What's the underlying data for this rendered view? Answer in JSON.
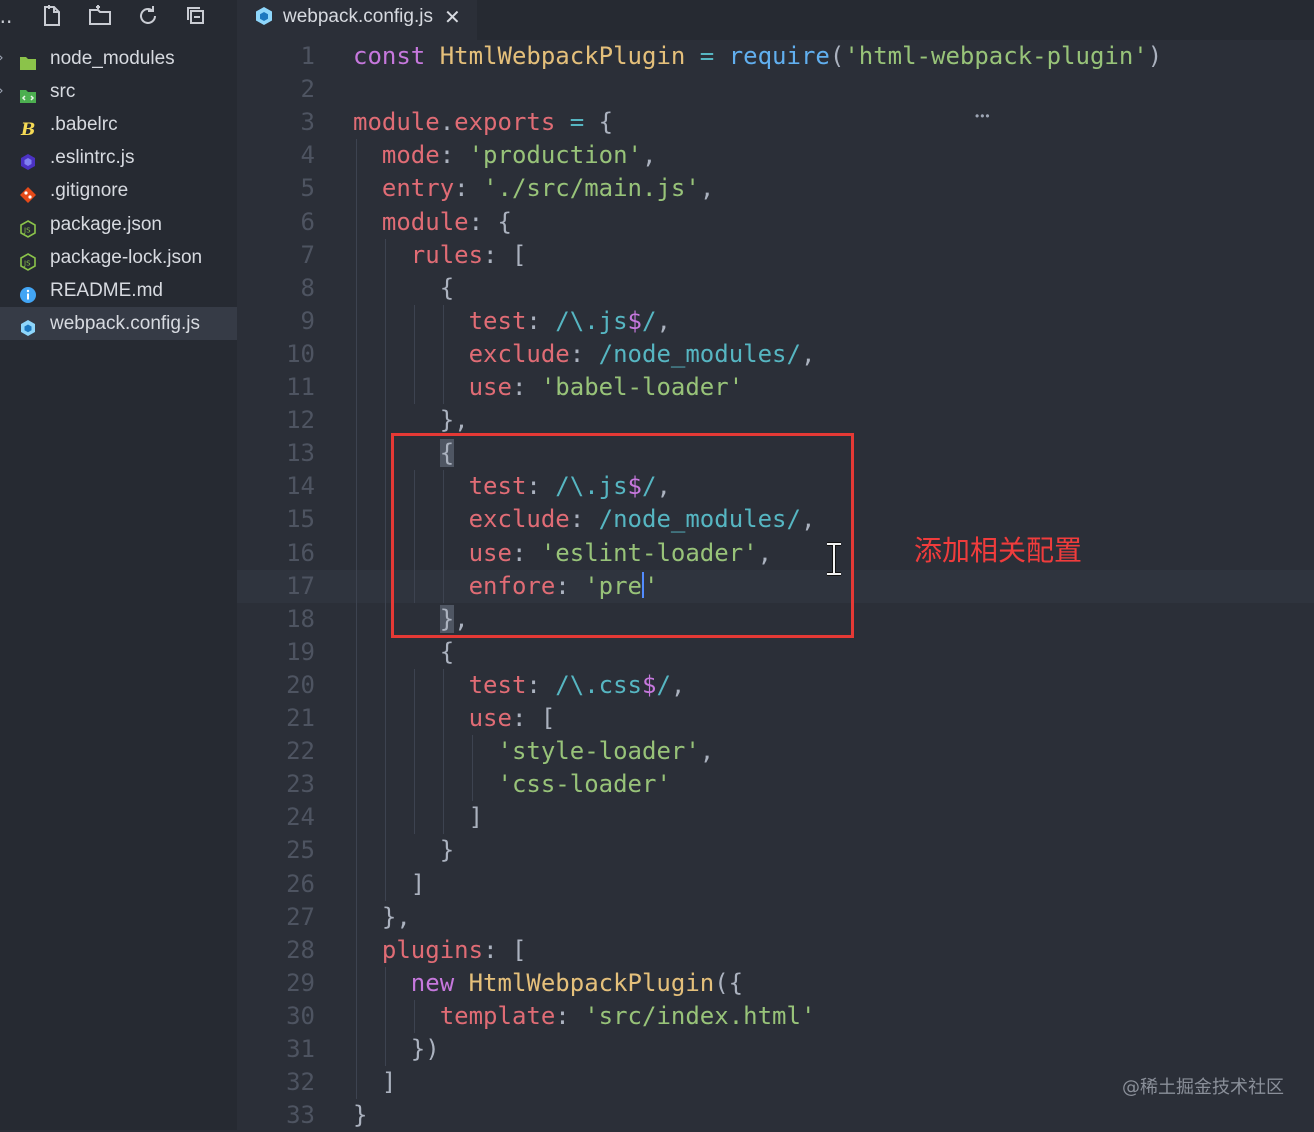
{
  "colors": {
    "sidebar_bg": "#262a32",
    "editor_bg": "#2b2f38",
    "annotation_red": "#e53935",
    "keyword": "#c678dd",
    "class_name": "#e5c07b",
    "function": "#61afef",
    "string": "#98c379",
    "property": "#e06c75",
    "regex": "#56b6c2",
    "line_number": "#4e5461"
  },
  "sidebar": {
    "toolbar_icons": [
      "new-file-icon",
      "new-folder-icon",
      "refresh-icon",
      "collapse-all-icon"
    ],
    "items": [
      {
        "label": "node_modules",
        "icon": "folder-icon",
        "chevron": "›"
      },
      {
        "label": "src",
        "icon": "src-folder-icon",
        "chevron": "›"
      },
      {
        "label": ".babelrc",
        "icon": "babel-icon",
        "chevron": ""
      },
      {
        "label": ".eslintrc.js",
        "icon": "eslint-icon",
        "chevron": ""
      },
      {
        "label": ".gitignore",
        "icon": "git-icon",
        "chevron": ""
      },
      {
        "label": "package.json",
        "icon": "node-icon",
        "chevron": ""
      },
      {
        "label": "package-lock.json",
        "icon": "node-icon",
        "chevron": ""
      },
      {
        "label": "README.md",
        "icon": "info-icon",
        "chevron": ""
      },
      {
        "label": "webpack.config.js",
        "icon": "webpack-icon",
        "chevron": "",
        "selected": true
      }
    ]
  },
  "tab": {
    "label": "webpack.config.js",
    "close": "✕",
    "icon": "webpack-icon"
  },
  "editor": {
    "current_line": 17,
    "lines": [
      {
        "n": "1",
        "tokens": [
          [
            "kw",
            "const "
          ],
          [
            "cls",
            "HtmlWebpackPlugin"
          ],
          [
            "pn",
            " "
          ],
          [
            "op",
            "="
          ],
          [
            "pn",
            " "
          ],
          [
            "fn",
            "require"
          ],
          [
            "pn",
            "("
          ],
          [
            "str",
            "'html-webpack-plugin'"
          ],
          [
            "pn",
            ")"
          ]
        ]
      },
      {
        "n": "2",
        "tokens": []
      },
      {
        "n": "3",
        "tokens": [
          [
            "prop",
            "module"
          ],
          [
            "pn",
            "."
          ],
          [
            "prop",
            "exports"
          ],
          [
            "pn",
            " "
          ],
          [
            "op",
            "="
          ],
          [
            "pn",
            " {"
          ]
        ]
      },
      {
        "n": "4",
        "tokens": [
          [
            "pn",
            "  "
          ],
          [
            "prop",
            "mode"
          ],
          [
            "pn",
            ": "
          ],
          [
            "str",
            "'production'"
          ],
          [
            "pn",
            ","
          ]
        ]
      },
      {
        "n": "5",
        "tokens": [
          [
            "pn",
            "  "
          ],
          [
            "prop",
            "entry"
          ],
          [
            "pn",
            ": "
          ],
          [
            "str",
            "'./src/main.js'"
          ],
          [
            "pn",
            ","
          ]
        ]
      },
      {
        "n": "6",
        "tokens": [
          [
            "pn",
            "  "
          ],
          [
            "prop",
            "module"
          ],
          [
            "pn",
            ": {"
          ]
        ]
      },
      {
        "n": "7",
        "tokens": [
          [
            "pn",
            "    "
          ],
          [
            "prop",
            "rules"
          ],
          [
            "pn",
            ": ["
          ]
        ]
      },
      {
        "n": "8",
        "tokens": [
          [
            "pn",
            "      {"
          ]
        ]
      },
      {
        "n": "9",
        "tokens": [
          [
            "pn",
            "        "
          ],
          [
            "prop",
            "test"
          ],
          [
            "pn",
            ": "
          ],
          [
            "re",
            "/\\.js"
          ],
          [
            "red",
            "$"
          ],
          [
            "re",
            "/"
          ],
          [
            "pn",
            ","
          ]
        ]
      },
      {
        "n": "10",
        "tokens": [
          [
            "pn",
            "        "
          ],
          [
            "prop",
            "exclude"
          ],
          [
            "pn",
            ": "
          ],
          [
            "re",
            "/node_modules/"
          ],
          [
            "pn",
            ","
          ]
        ]
      },
      {
        "n": "11",
        "tokens": [
          [
            "pn",
            "        "
          ],
          [
            "prop",
            "use"
          ],
          [
            "pn",
            ": "
          ],
          [
            "str",
            "'babel-loader'"
          ]
        ]
      },
      {
        "n": "12",
        "tokens": [
          [
            "pn",
            "      },"
          ]
        ]
      },
      {
        "n": "13",
        "tokens": [
          [
            "pn",
            "      "
          ],
          [
            "hl",
            "{"
          ]
        ]
      },
      {
        "n": "14",
        "tokens": [
          [
            "pn",
            "        "
          ],
          [
            "prop",
            "test"
          ],
          [
            "pn",
            ": "
          ],
          [
            "re",
            "/\\.js"
          ],
          [
            "red",
            "$"
          ],
          [
            "re",
            "/"
          ],
          [
            "pn",
            ","
          ]
        ]
      },
      {
        "n": "15",
        "tokens": [
          [
            "pn",
            "        "
          ],
          [
            "prop",
            "exclude"
          ],
          [
            "pn",
            ": "
          ],
          [
            "re",
            "/node_modules/"
          ],
          [
            "pn",
            ","
          ]
        ]
      },
      {
        "n": "16",
        "tokens": [
          [
            "pn",
            "        "
          ],
          [
            "prop",
            "use"
          ],
          [
            "pn",
            ": "
          ],
          [
            "str",
            "'eslint-loader'"
          ],
          [
            "pn",
            ","
          ]
        ]
      },
      {
        "n": "17",
        "tokens": [
          [
            "pn",
            "        "
          ],
          [
            "prop",
            "enfore"
          ],
          [
            "pn",
            ": "
          ],
          [
            "str",
            "'pre"
          ],
          [
            "cursor",
            ""
          ],
          [
            "str",
            "'"
          ]
        ]
      },
      {
        "n": "18",
        "tokens": [
          [
            "pn",
            "      "
          ],
          [
            "hl",
            "}"
          ],
          [
            "pn",
            ","
          ]
        ]
      },
      {
        "n": "19",
        "tokens": [
          [
            "pn",
            "      {"
          ]
        ]
      },
      {
        "n": "20",
        "tokens": [
          [
            "pn",
            "        "
          ],
          [
            "prop",
            "test"
          ],
          [
            "pn",
            ": "
          ],
          [
            "re",
            "/\\.css"
          ],
          [
            "red",
            "$"
          ],
          [
            "re",
            "/"
          ],
          [
            "pn",
            ","
          ]
        ]
      },
      {
        "n": "21",
        "tokens": [
          [
            "pn",
            "        "
          ],
          [
            "prop",
            "use"
          ],
          [
            "pn",
            ": ["
          ]
        ]
      },
      {
        "n": "22",
        "tokens": [
          [
            "pn",
            "          "
          ],
          [
            "str",
            "'style-loader'"
          ],
          [
            "pn",
            ","
          ]
        ]
      },
      {
        "n": "23",
        "tokens": [
          [
            "pn",
            "          "
          ],
          [
            "str",
            "'css-loader'"
          ]
        ]
      },
      {
        "n": "24",
        "tokens": [
          [
            "pn",
            "        ]"
          ]
        ]
      },
      {
        "n": "25",
        "tokens": [
          [
            "pn",
            "      }"
          ]
        ]
      },
      {
        "n": "26",
        "tokens": [
          [
            "pn",
            "    ]"
          ]
        ]
      },
      {
        "n": "27",
        "tokens": [
          [
            "pn",
            "  },"
          ]
        ]
      },
      {
        "n": "28",
        "tokens": [
          [
            "pn",
            "  "
          ],
          [
            "prop",
            "plugins"
          ],
          [
            "pn",
            ": ["
          ]
        ]
      },
      {
        "n": "29",
        "tokens": [
          [
            "pn",
            "    "
          ],
          [
            "kw",
            "new "
          ],
          [
            "cls",
            "HtmlWebpackPlugin"
          ],
          [
            "pn",
            "({"
          ]
        ]
      },
      {
        "n": "30",
        "tokens": [
          [
            "pn",
            "      "
          ],
          [
            "prop",
            "template"
          ],
          [
            "pn",
            ": "
          ],
          [
            "str",
            "'src/index.html'"
          ]
        ]
      },
      {
        "n": "31",
        "tokens": [
          [
            "pn",
            "    })"
          ]
        ]
      },
      {
        "n": "32",
        "tokens": [
          [
            "pn",
            "  ]"
          ]
        ]
      },
      {
        "n": "33",
        "tokens": [
          [
            "pn",
            "}"
          ]
        ]
      }
    ]
  },
  "annotation": {
    "text": "添加相关配置"
  },
  "watermark": "@稀土掘金技术社区"
}
